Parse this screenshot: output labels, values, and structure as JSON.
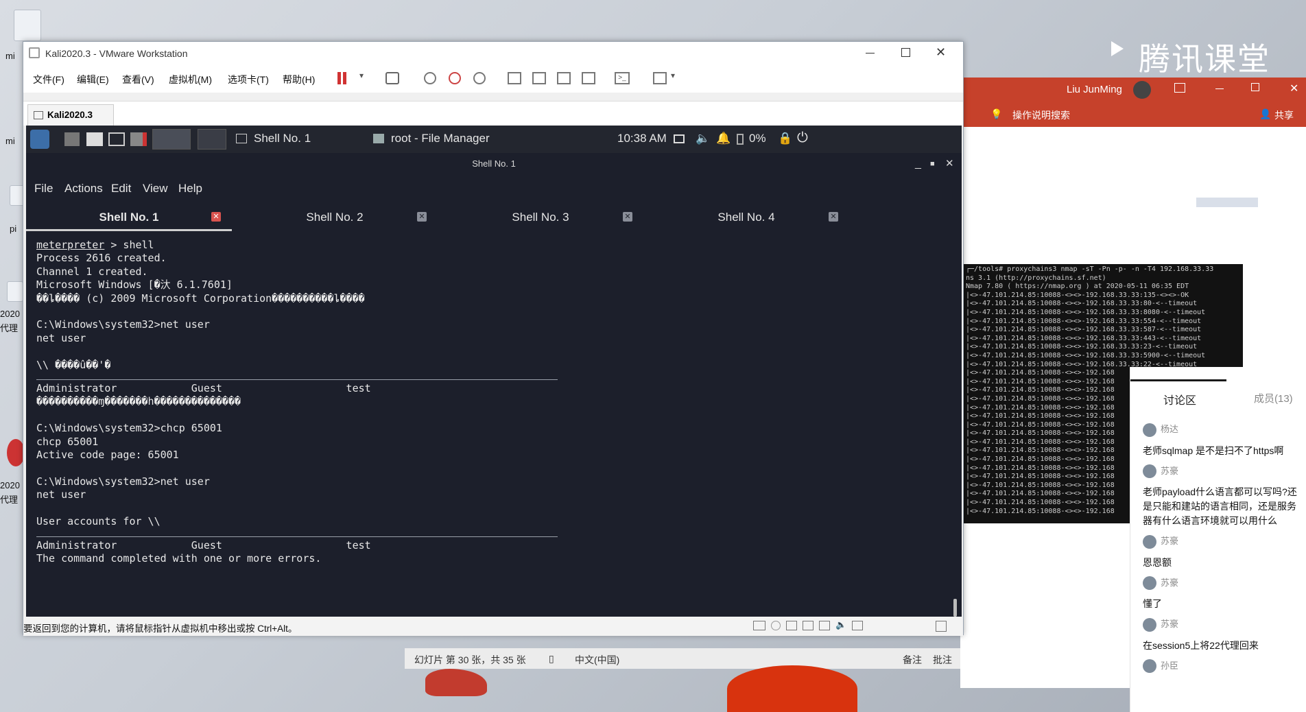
{
  "desktop": {
    "icon_labels": [
      "mi",
      "mi",
      "pi",
      "2020",
      "代理",
      "2020",
      "代理"
    ],
    "brand": "腾讯课堂"
  },
  "vmware": {
    "title": "Kali2020.3 - VMware Workstation",
    "menu": [
      "文件(F)",
      "编辑(E)",
      "查看(V)",
      "虚拟机(M)",
      "选项卡(T)",
      "帮助(H)"
    ],
    "tab": "Kali2020.3",
    "status_hint": "要返回到您的计算机，请将鼠标指针从虚拟机中移出或按 Ctrl+Alt。"
  },
  "kali_panel": {
    "shell_task": "Shell No. 1",
    "file_task": "root - File Manager",
    "clock": "10:38 AM",
    "battery": "0%"
  },
  "terminal": {
    "window_title": "Shell No. 1",
    "menu": [
      "File",
      "Actions",
      "Edit",
      "View",
      "Help"
    ],
    "tabs": [
      "Shell No. 1",
      "Shell No. 2",
      "Shell No. 3",
      "Shell No. 4"
    ],
    "active_tab": 0,
    "prompt_word": "meterpreter",
    "prompt_rest": " > shell",
    "block1": "Process 2616 created.\nChannel 1 created.\nMicrosoft Windows [�汏 6.1.7601]\n��ȴ���� (c) 2009 Microsoft Corporation����������ȴ����\n\nC:\\Windows\\system32>net user\nnet user\n\n\\\\ ����û��'�\n",
    "users_line": "Administrator            Guest                    test",
    "garbled_line": "����������ɱ�������h��������������",
    "block2": "\n\nC:\\Windows\\system32>chcp 65001\nchcp 65001\nActive code page: 65001\n\nC:\\Windows\\system32>net user\nnet user\n\nUser accounts for \\\\\n",
    "users_line2": "Administrator            Guest                    test",
    "final_line": "The command completed with one or more errors."
  },
  "ppt": {
    "user": "Liu JunMing",
    "search": "操作说明搜索",
    "share": "共享",
    "slide_status": "幻灯片 第 30 张，共 35 张",
    "lang": "中文(中国)",
    "notes": "备注",
    "comments": "批注"
  },
  "nmap_lines": [
    "┌─/tools# proxychains3 nmap -sT -Pn -p- -n -T4 192.168.33.33",
    "ns 3.1 (http://proxychains.sf.net)",
    "Nmap 7.80 ( https://nmap.org ) at 2020-05-11 06:35 EDT",
    "|<>-47.101.214.85:10088-<><>-192.168.33.33:135-<><>-OK",
    "|<>-47.101.214.85:10088-<><>-192.168.33.33:80-<--timeout",
    "|<>-47.101.214.85:10088-<><>-192.168.33.33:8080-<--timeout",
    "|<>-47.101.214.85:10088-<><>-192.168.33.33:554-<--timeout",
    "|<>-47.101.214.85:10088-<><>-192.168.33.33:587-<--timeout",
    "|<>-47.101.214.85:10088-<><>-192.168.33.33:443-<--timeout",
    "|<>-47.101.214.85:10088-<><>-192.168.33.33:23-<--timeout",
    "|<>-47.101.214.85:10088-<><>-192.168.33.33:5900-<--timeout",
    "|<>-47.101.214.85:10088-<><>-192.168.33.33:22-<--timeout",
    "|<>-47.101.214.85:10088-<><>-192.168",
    "|<>-47.101.214.85:10088-<><>-192.168",
    "|<>-47.101.214.85:10088-<><>-192.168",
    "|<>-47.101.214.85:10088-<><>-192.168",
    "|<>-47.101.214.85:10088-<><>-192.168",
    "|<>-47.101.214.85:10088-<><>-192.168",
    "|<>-47.101.214.85:10088-<><>-192.168",
    "|<>-47.101.214.85:10088-<><>-192.168",
    "|<>-47.101.214.85:10088-<><>-192.168",
    "|<>-47.101.214.85:10088-<><>-192.168",
    "|<>-47.101.214.85:10088-<><>-192.168",
    "|<>-47.101.214.85:10088-<><>-192.168",
    "|<>-47.101.214.85:10088-<><>-192.168",
    "|<>-47.101.214.85:10088-<><>-192.168",
    "|<>-47.101.214.85:10088-<><>-192.168",
    "|<>-47.101.214.85:10088-<><>-192.168",
    "|<>-47.101.214.85:10088-<><>-192.168"
  ],
  "discussion": {
    "tab": "讨论区",
    "members": "成员(13)",
    "messages": [
      {
        "name": "杨达",
        "text": "老师sqlmap 是不是扫不了https啊"
      },
      {
        "name": "苏豪",
        "text": "老师payload什么语言都可以写吗?还是只能和建站的语言相同，还是服务器有什么语言环境就可以用什么"
      },
      {
        "name": "苏豪",
        "text": "恩恩额"
      },
      {
        "name": "苏豪",
        "text": "懂了"
      },
      {
        "name": "苏豪",
        "text": "在session5上将22代理回来"
      },
      {
        "name": "孙臣",
        "text": ""
      }
    ]
  }
}
